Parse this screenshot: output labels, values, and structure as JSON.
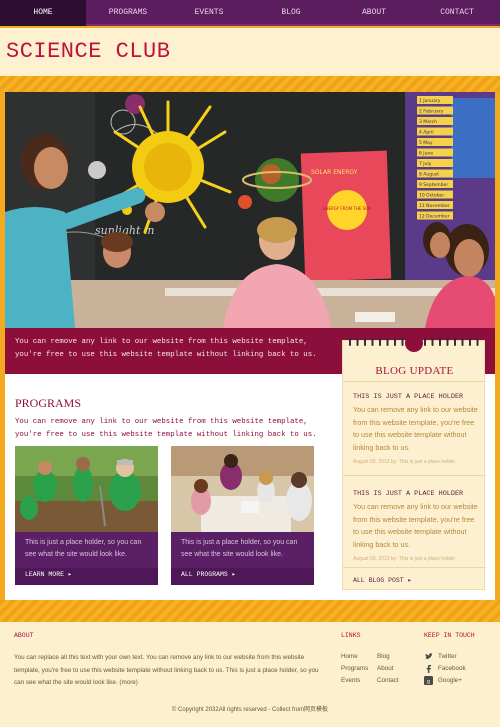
{
  "nav": {
    "items": [
      {
        "label": "HOME",
        "active": true
      },
      {
        "label": "PROGRAMS",
        "active": false
      },
      {
        "label": "EVENTS",
        "active": false
      },
      {
        "label": "BLOG",
        "active": false
      },
      {
        "label": "ABOUT",
        "active": false
      },
      {
        "label": "CONTACT",
        "active": false
      }
    ]
  },
  "header": {
    "title": "SCIENCE CLUB"
  },
  "hero": {
    "poster_line1": "SOLAR  ENERGY",
    "poster_line2": "ENERGY FROM THE SUN",
    "board_text": "sunlight in",
    "months": [
      "1 January",
      "2 February",
      "3 March",
      "4 April",
      "5 May",
      "6 June",
      "7 July",
      "8 August",
      "9 September",
      "10 October",
      "11 November",
      "12 December"
    ],
    "caption": "You can remove any link to our website from this website template, you're free to use this website template without linking back to us."
  },
  "programs": {
    "title": "PROGRAMS",
    "text": "You can remove any link to our website from this website template, you're free to use this website template without linking back to us.",
    "cards": [
      {
        "text": "This is just a place holder, so you can see what the site would look like.",
        "link": "LEARN MORE ▸"
      },
      {
        "text": "This is just a place holder, so you can see what the site would look like.",
        "link": "ALL PROGRAMS ▸"
      }
    ]
  },
  "blog": {
    "title": "BLOG UPDATE",
    "posts": [
      {
        "title": "THIS IS JUST A PLACE HOLDER",
        "body": "You can remove any link to our website from this website template, you're free to use this website template without linking back to us.",
        "meta": "August 00, 2012 by: This is just a place holder"
      },
      {
        "title": "THIS IS JUST A PLACE HOLDER",
        "body": "You can remove any link to our website from this website template, you're free to use this website template without linking back to us.",
        "meta": "August 00, 2012 by: This is just a place holder"
      }
    ],
    "all_link": "ALL BLOG POST ▸"
  },
  "footer": {
    "about_heading": "ABOUT",
    "about_text": "You can replace all this text with your own text. You can remove any link to our website from this website template, you're free to use this website template without linking back to us. This is just a place holder, so you can see what the site would look like. (more)",
    "links_heading": "LINKS",
    "links": [
      "Home",
      "Blog",
      "Programs",
      "About",
      "Events",
      "Contact"
    ],
    "social_heading": "KEEP IN TOUCH",
    "social": [
      "Twitter",
      "Facebook",
      "Google+"
    ],
    "copyright": "© Copyright 2032All rights reserved - Collect from网页模板"
  },
  "colors": {
    "nav_bg": "#5b1d5e",
    "brand_red": "#c0123c",
    "caption_bg": "#8c0f3b",
    "orange": "#f4a91e",
    "cream": "#fdf1cf"
  }
}
